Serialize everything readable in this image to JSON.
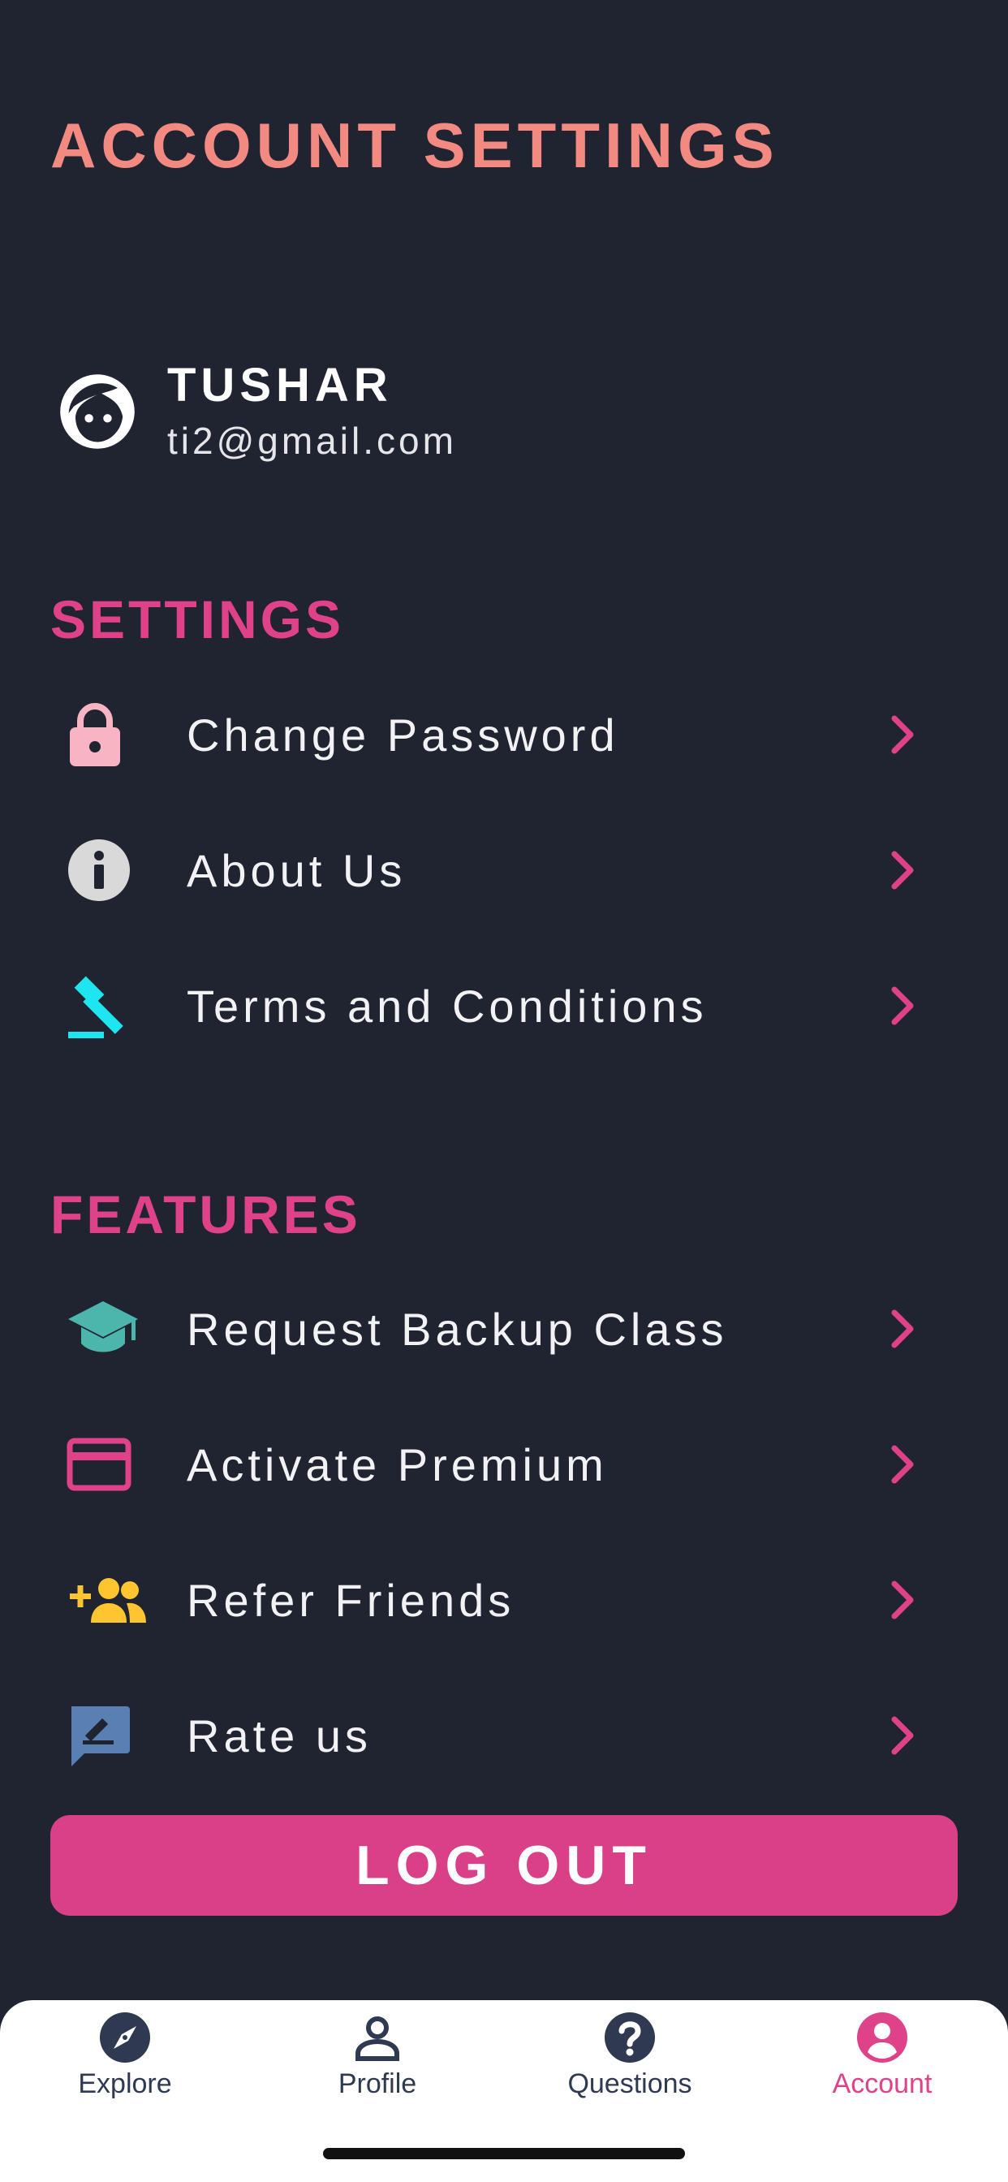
{
  "header": {
    "title": "ACCOUNT SETTINGS"
  },
  "user": {
    "name": "TUSHAR",
    "email": "ti2@gmail.com"
  },
  "settings": {
    "title": "SETTINGS",
    "items": [
      {
        "label": "Change Password",
        "icon": "lock-icon",
        "color": "#f9b4c4"
      },
      {
        "label": "About Us",
        "icon": "info-icon",
        "color": "#d9d9d9"
      },
      {
        "label": "Terms and Conditions",
        "icon": "gavel-icon",
        "color": "#1ee6f0"
      }
    ]
  },
  "features": {
    "title": "FEATURES",
    "items": [
      {
        "label": "Request Backup Class",
        "icon": "graduation-cap-icon",
        "color": "#4db6ac"
      },
      {
        "label": "Activate Premium",
        "icon": "credit-card-icon",
        "color": "#e0428a"
      },
      {
        "label": "Refer Friends",
        "icon": "add-group-icon",
        "color": "#ffc531"
      },
      {
        "label": "Rate us",
        "icon": "rate-review-icon",
        "color": "#5a7fb3"
      }
    ]
  },
  "logout": {
    "label": "LOG OUT"
  },
  "tabs": [
    {
      "label": "Explore",
      "icon": "compass-icon",
      "active": false
    },
    {
      "label": "Profile",
      "icon": "person-icon",
      "active": false
    },
    {
      "label": "Questions",
      "icon": "question-icon",
      "active": false
    },
    {
      "label": "Account",
      "icon": "account-circle-icon",
      "active": true
    }
  ],
  "colors": {
    "background": "#1f2430",
    "title": "#f38a82",
    "accent": "#e0428a",
    "tab_inactive": "#2f3a52"
  }
}
